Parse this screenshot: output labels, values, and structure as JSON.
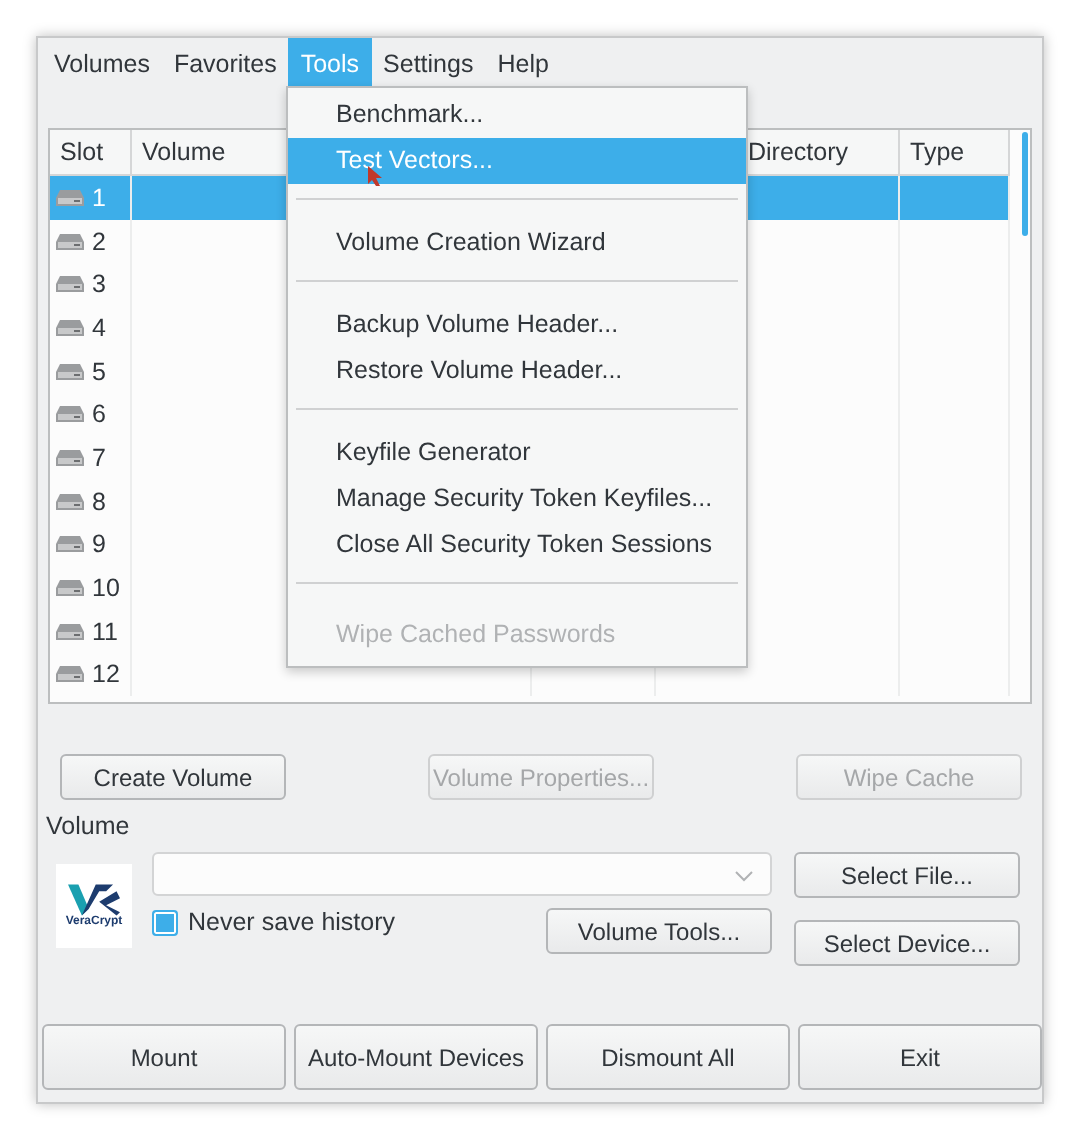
{
  "menu_bar": [
    {
      "label": "Volumes",
      "selected": false
    },
    {
      "label": "Favorites",
      "selected": false
    },
    {
      "label": "Tools",
      "selected": true
    },
    {
      "label": "Settings",
      "selected": false
    },
    {
      "label": "Help",
      "selected": false
    }
  ],
  "tools_menu": [
    {
      "kind": "item",
      "label": "Benchmark...",
      "highlighted": false,
      "disabled": false
    },
    {
      "kind": "item",
      "label": "Test Vectors...",
      "highlighted": true,
      "disabled": false
    },
    {
      "kind": "separator"
    },
    {
      "kind": "item",
      "label": "Volume Creation Wizard",
      "highlighted": false,
      "disabled": false
    },
    {
      "kind": "separator"
    },
    {
      "kind": "item",
      "label": "Backup Volume Header...",
      "highlighted": false,
      "disabled": false
    },
    {
      "kind": "item",
      "label": "Restore Volume Header...",
      "highlighted": false,
      "disabled": false
    },
    {
      "kind": "separator"
    },
    {
      "kind": "item",
      "label": "Keyfile Generator",
      "highlighted": false,
      "disabled": false
    },
    {
      "kind": "item",
      "label": "Manage Security Token Keyfiles...",
      "highlighted": false,
      "disabled": false
    },
    {
      "kind": "item",
      "label": "Close All Security Token Sessions",
      "highlighted": false,
      "disabled": false
    },
    {
      "kind": "separator"
    },
    {
      "kind": "item",
      "label": "Wipe Cached Passwords",
      "highlighted": false,
      "disabled": true
    }
  ],
  "table": {
    "columns": [
      "Slot",
      "Volume",
      "Directory",
      "Type"
    ],
    "rows": [
      {
        "slot": "1",
        "selected": true
      },
      {
        "slot": "2",
        "selected": false
      },
      {
        "slot": "3",
        "selected": false
      },
      {
        "slot": "4",
        "selected": false
      },
      {
        "slot": "5",
        "selected": false
      },
      {
        "slot": "6",
        "selected": false
      },
      {
        "slot": "7",
        "selected": false
      },
      {
        "slot": "8",
        "selected": false
      },
      {
        "slot": "9",
        "selected": false
      },
      {
        "slot": "10",
        "selected": false
      },
      {
        "slot": "11",
        "selected": false
      },
      {
        "slot": "12",
        "selected": false
      }
    ]
  },
  "volume_buttons": [
    {
      "label": "Create Volume",
      "disabled": false
    },
    {
      "label": "Volume Properties...",
      "disabled": true
    },
    {
      "label": "Wipe Cache",
      "disabled": true
    }
  ],
  "volume_section": {
    "label": "Volume",
    "logo_text": "VeraCrypt",
    "select_file": "Select File...",
    "never_save_history": {
      "label": "Never save history",
      "checked": true
    },
    "volume_tools": "Volume Tools...",
    "select_device": "Select Device..."
  },
  "bottom_buttons": [
    "Mount",
    "Auto-Mount Devices",
    "Dismount All",
    "Exit"
  ]
}
